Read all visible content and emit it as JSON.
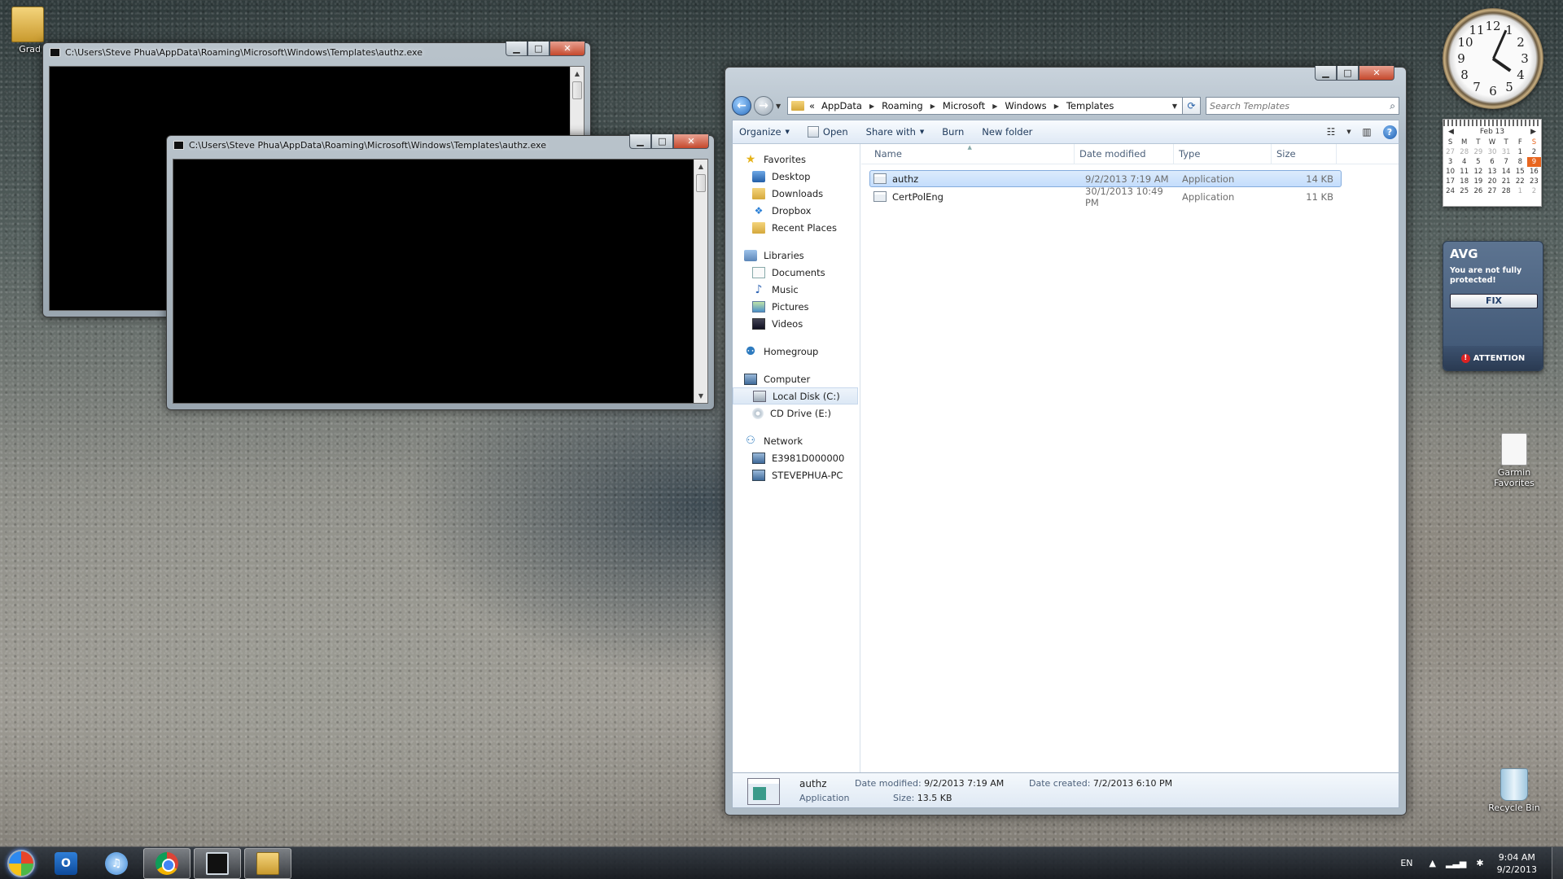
{
  "desktop": {
    "icons": [
      {
        "label": "Grad",
        "icon": "folder-icon"
      },
      {
        "label": "Garmin Favorites",
        "icon": "document-icon"
      },
      {
        "label": "Recycle Bin",
        "icon": "recycle-bin-icon"
      }
    ]
  },
  "console_back": {
    "title": "C:\\Users\\Steve Phua\\AppData\\Roaming\\Microsoft\\Windows\\Templates\\authz.exe"
  },
  "console_front": {
    "title": "C:\\Users\\Steve Phua\\AppData\\Roaming\\Microsoft\\Windows\\Templates\\authz.exe"
  },
  "explorer": {
    "breadcrumb": {
      "overflow": "«",
      "items": [
        "AppData",
        "Roaming",
        "Microsoft",
        "Windows",
        "Templates"
      ]
    },
    "search": {
      "placeholder": "Search Templates"
    },
    "toolbar": {
      "organize": "Organize",
      "open": "Open",
      "share_with": "Share with",
      "burn": "Burn",
      "new_folder": "New folder"
    },
    "nav": {
      "favorites": {
        "label": "Favorites",
        "items": [
          "Desktop",
          "Downloads",
          "Dropbox",
          "Recent Places"
        ]
      },
      "libraries": {
        "label": "Libraries",
        "items": [
          "Documents",
          "Music",
          "Pictures",
          "Videos"
        ]
      },
      "homegroup": {
        "label": "Homegroup"
      },
      "computer": {
        "label": "Computer",
        "items": [
          "Local Disk (C:)",
          "CD Drive (E:)"
        ]
      },
      "network": {
        "label": "Network",
        "items": [
          "E3981D000000",
          "STEVEPHUA-PC"
        ]
      }
    },
    "columns": {
      "name": "Name",
      "date_modified": "Date modified",
      "type": "Type",
      "size": "Size"
    },
    "files": [
      {
        "name": "authz",
        "date_modified": "9/2/2013 7:19 AM",
        "type": "Application",
        "size": "14 KB",
        "selected": true
      },
      {
        "name": "CertPolEng",
        "date_modified": "30/1/2013 10:49 PM",
        "type": "Application",
        "size": "11 KB",
        "selected": false
      }
    ],
    "details": {
      "name": "authz",
      "type": "Application",
      "date_modified_label": "Date modified:",
      "date_modified": "9/2/2013 7:19 AM",
      "size_label": "Size:",
      "size": "13.5 KB",
      "date_created_label": "Date created:",
      "date_created": "7/2/2013 6:10 PM"
    }
  },
  "gadgets": {
    "clock": {
      "numbers": [
        "12",
        "1",
        "2",
        "3",
        "4",
        "5",
        "6",
        "7",
        "8",
        "9",
        "10",
        "11"
      ]
    },
    "calendar": {
      "month": "Feb 13",
      "weekdays": [
        "S",
        "M",
        "T",
        "W",
        "T",
        "F",
        "S"
      ],
      "weeks": [
        [
          "27",
          "28",
          "29",
          "30",
          "31",
          "1",
          "2"
        ],
        [
          "3",
          "4",
          "5",
          "6",
          "7",
          "8",
          "9"
        ],
        [
          "10",
          "11",
          "12",
          "13",
          "14",
          "15",
          "16"
        ],
        [
          "17",
          "18",
          "19",
          "20",
          "21",
          "22",
          "23"
        ],
        [
          "24",
          "25",
          "26",
          "27",
          "28",
          "1",
          "2"
        ]
      ]
    },
    "avg": {
      "brand": "AVG",
      "message": "You are not fully protected!",
      "fix": "FIX",
      "attention": "ATTENTION"
    }
  },
  "taskbar": {
    "apps": [
      "outlook-icon",
      "itunes-icon",
      "chrome-icon",
      "console-icon",
      "windows-explorer-icon"
    ],
    "tray": {
      "language": "EN",
      "time": "9:04 AM",
      "date": "9/2/2013"
    }
  }
}
